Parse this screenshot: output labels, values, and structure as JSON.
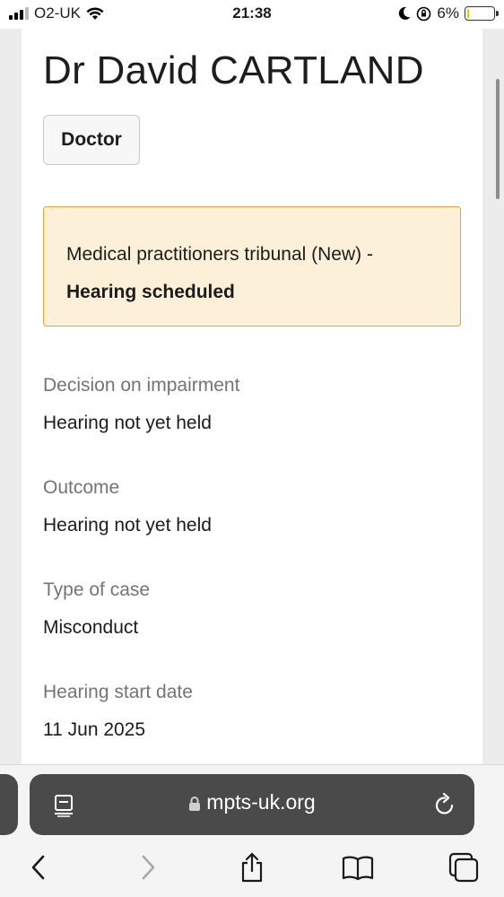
{
  "status": {
    "carrier": "O2-UK",
    "time": "21:38",
    "battery": "6%",
    "battery_level": 0.06,
    "icons": [
      "signal-icon",
      "wifi-icon",
      "moon-icon",
      "orientation-lock-icon",
      "battery-icon"
    ]
  },
  "page": {
    "title": "Dr David CARTLAND",
    "tag": "Doctor",
    "notice": {
      "text": "Medical practitioners tribunal (New) -",
      "strong": "Hearing scheduled",
      "background": "#fdf0d9",
      "border": "#e0a43a"
    },
    "fields": [
      {
        "label": "Decision on impairment",
        "value": "Hearing not yet held"
      },
      {
        "label": "Outcome",
        "value": "Hearing not yet held"
      },
      {
        "label": "Type of case",
        "value": "Misconduct"
      },
      {
        "label": "Hearing start date",
        "value": "11 Jun 2025"
      }
    ]
  },
  "browser": {
    "url": "mpts-uk.org",
    "toolbar_icons": [
      "back-icon",
      "forward-icon",
      "share-icon",
      "bookmarks-icon",
      "tabs-icon"
    ]
  }
}
